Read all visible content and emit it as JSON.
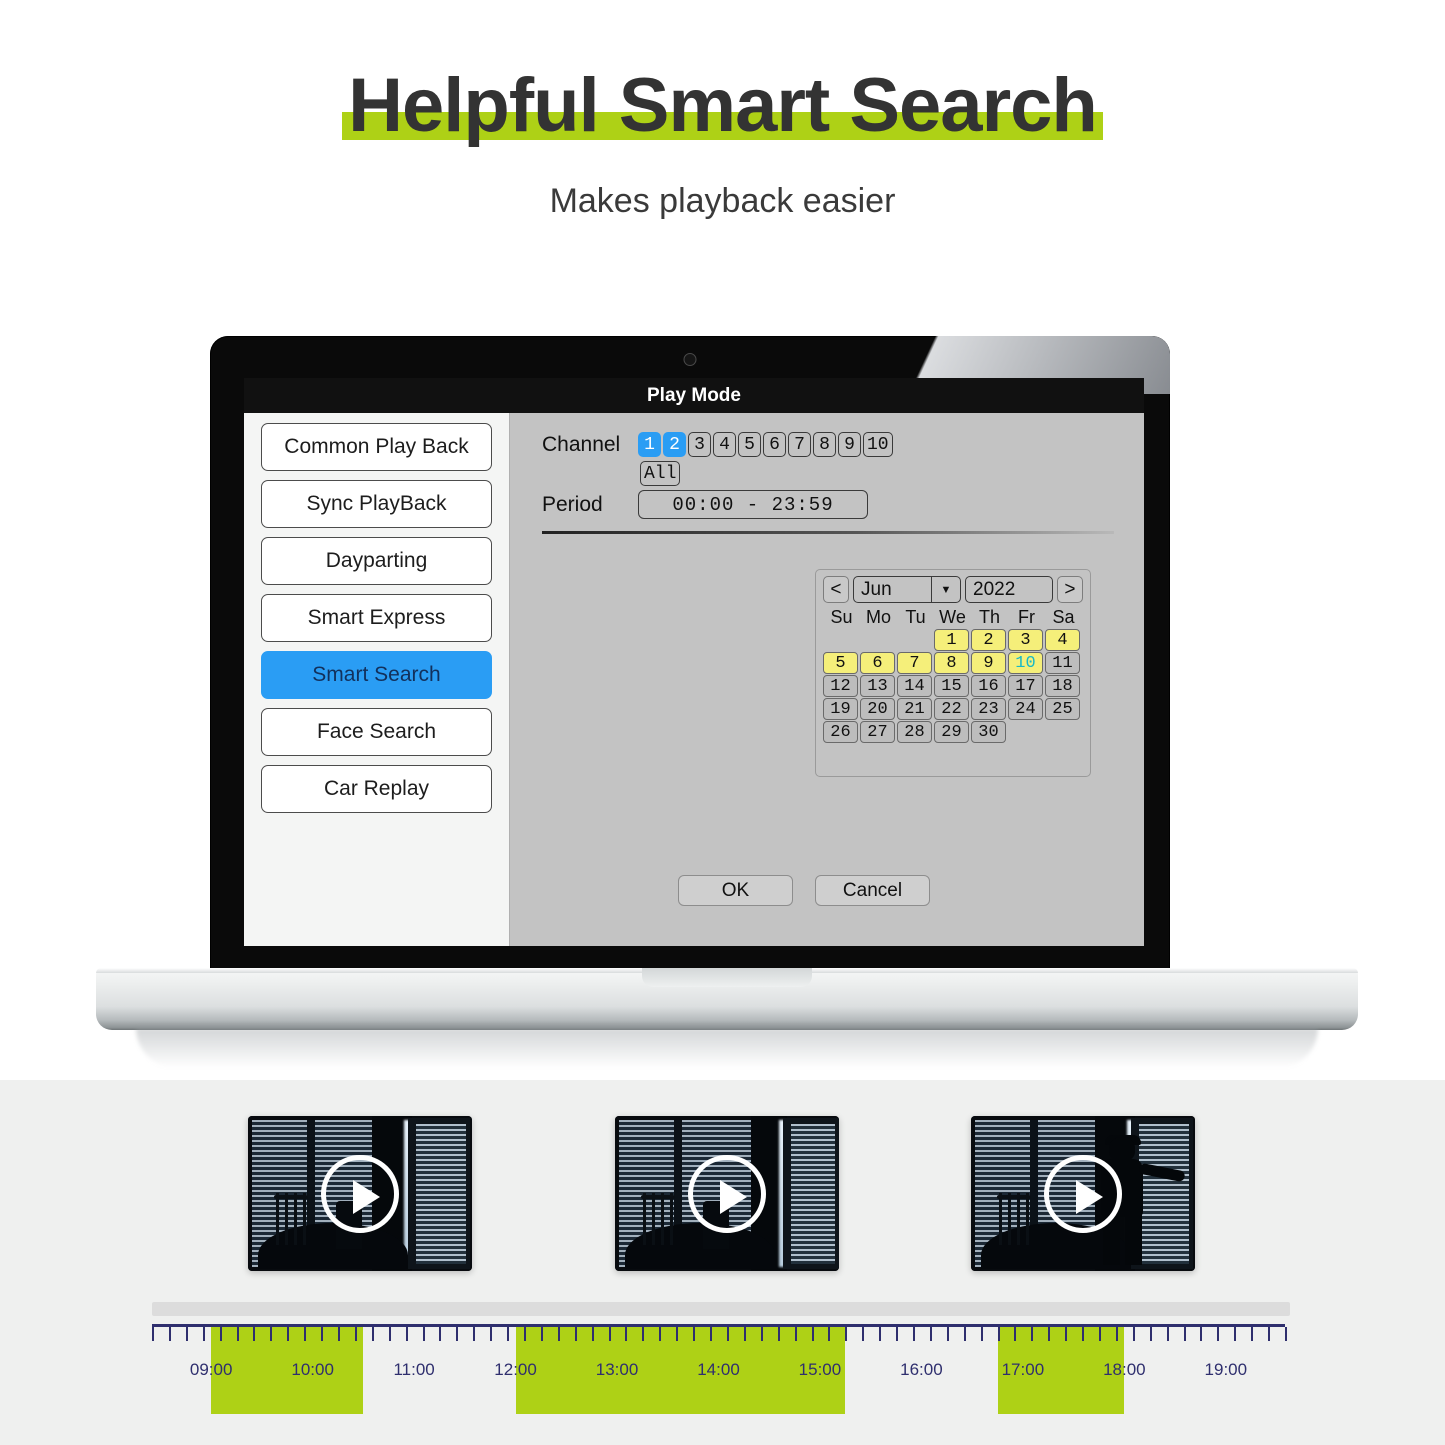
{
  "header": {
    "title": "Helpful Smart Search",
    "subtitle": "Makes playback easier",
    "highlight_color": "#aed116"
  },
  "dialog": {
    "titlebar": "Play Mode",
    "sidebar": [
      {
        "label": "Common Play Back",
        "active": false
      },
      {
        "label": "Sync PlayBack",
        "active": false
      },
      {
        "label": "Dayparting",
        "active": false
      },
      {
        "label": "Smart Express",
        "active": false
      },
      {
        "label": "Smart Search",
        "active": true
      },
      {
        "label": "Face Search",
        "active": false
      },
      {
        "label": "Car Replay",
        "active": false
      }
    ],
    "channel": {
      "label": "Channel",
      "options": [
        "1",
        "2",
        "3",
        "4",
        "5",
        "6",
        "7",
        "8",
        "9",
        "10"
      ],
      "selected": [
        "1",
        "2"
      ],
      "all_label": "All",
      "selected_color": "#2a9df4"
    },
    "period": {
      "label": "Period",
      "start": "00:00",
      "separator": "-",
      "end": "23:59",
      "value": "00:00   -   23:59"
    },
    "calendar": {
      "prev_label": "<",
      "next_label": ">",
      "month": "Jun",
      "year": "2022",
      "dropdown_icon": "chevron-down-icon",
      "weekdays": [
        "Su",
        "Mo",
        "Tu",
        "We",
        "Th",
        "Fr",
        "Sa"
      ],
      "weeks": [
        [
          null,
          null,
          null,
          "1",
          "2",
          "3",
          "4"
        ],
        [
          "5",
          "6",
          "7",
          "8",
          "9",
          "10",
          "11"
        ],
        [
          "12",
          "13",
          "14",
          "15",
          "16",
          "17",
          "18"
        ],
        [
          "19",
          "20",
          "21",
          "22",
          "23",
          "24",
          "25"
        ],
        [
          "26",
          "27",
          "28",
          "29",
          "30",
          null,
          null
        ]
      ],
      "recorded_days": [
        "1",
        "2",
        "3",
        "4",
        "5",
        "6",
        "7",
        "8",
        "9",
        "10"
      ],
      "selected_day": "10",
      "recorded_color": "#f5ef7a",
      "selected_text_color": "#18b8c8"
    },
    "buttons": {
      "ok": "OK",
      "cancel": "Cancel"
    }
  },
  "clips": [
    {
      "caption": "night-vision-room-blinds",
      "has_person": false
    },
    {
      "caption": "night-vision-door-open",
      "has_person": false
    },
    {
      "caption": "night-vision-intruder",
      "has_person": true
    }
  ],
  "timeline": {
    "hours": [
      "09:00",
      "10:00",
      "11:00",
      "12:00",
      "13:00",
      "14:00",
      "15:00",
      "16:00",
      "17:00",
      "18:00",
      "19:00"
    ],
    "segments": [
      {
        "start": "09:00",
        "end": "10:30"
      },
      {
        "start": "12:00",
        "end": "15:15"
      },
      {
        "start": "16:45",
        "end": "18:00"
      }
    ],
    "event_color": "#aed116",
    "axis_color": "#2f2f6e"
  }
}
